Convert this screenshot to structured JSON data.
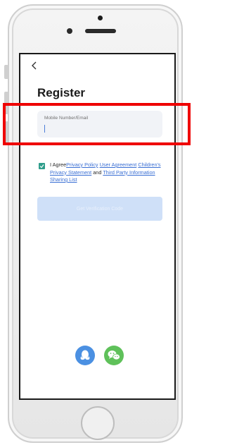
{
  "colors": {
    "accent": "#3a6fd4",
    "checkbox": "#2f9d8b",
    "button_disabled": "#cfe0f8",
    "highlight": "#ef0000",
    "qq": "#4b90e2",
    "wechat": "#5fc15a"
  },
  "page": {
    "title": "Register"
  },
  "form": {
    "input_placeholder": "Mobile Number/Email",
    "input_value": ""
  },
  "agreement": {
    "checked": true,
    "prefix": "I Agree",
    "privacy_policy": "Privacy Policy",
    "user_agreement": "User Agreement",
    "children_privacy": "Children's Privacy Statement",
    "and": "and",
    "third_party": "Third Party Information Sharing List"
  },
  "button": {
    "label": "Get Verification Code"
  },
  "social": {
    "icons": [
      "qq-icon",
      "wechat-icon"
    ]
  }
}
